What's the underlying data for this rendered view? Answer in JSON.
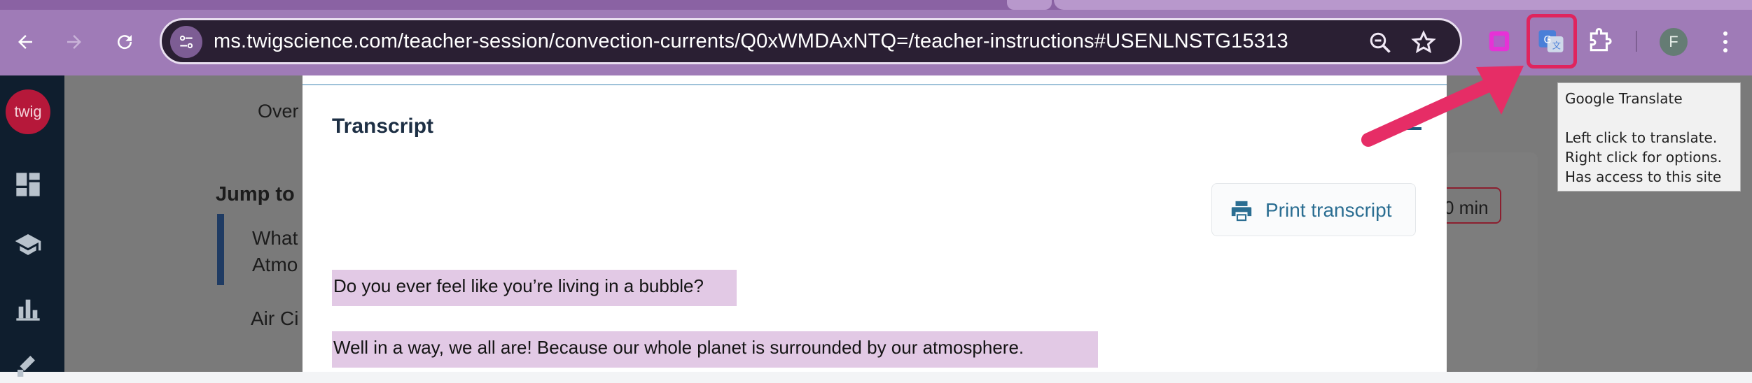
{
  "browser": {
    "url": "ms.twigscience.com/teacher-session/convection-currents/Q0xWMDAxNTQ=/teacher-instructions#USENLNSTG15313",
    "profile_initial": "F",
    "icons": [
      "back-arrow-icon",
      "forward-arrow-icon",
      "reload-icon",
      "site-info-icon",
      "zoom-icon",
      "bookmark-star-icon",
      "extension-pink-icon",
      "google-translate-icon",
      "extensions-puzzle-icon",
      "more-menu-icon"
    ]
  },
  "tooltip": {
    "title": "Google Translate",
    "line1": "Left click to translate.",
    "line2": "Right click for options.",
    "line3": "Has access to this site"
  },
  "app": {
    "logo_text": "twig",
    "sidebar_icons": [
      "dashboard-icon",
      "graduation-cap-icon",
      "bar-chart-icon",
      "tools-icon"
    ],
    "background": {
      "tab_label": "Over",
      "jump_label": "Jump to",
      "link1_line1": "What",
      "link1_line2": "Atmo",
      "link2": "Air Ci",
      "time_text": "0 min"
    }
  },
  "modal": {
    "title": "Transcript",
    "print_label": "Print transcript",
    "lines": [
      "Do you ever feel like you’re living in a bubble?",
      "Well in a way, we all are! Because our whole planet is surrounded by our atmosphere."
    ]
  },
  "colors": {
    "chrome": "#9f7bb7",
    "omnibox": "#2a1f33",
    "highlight": "#e0245e",
    "transcript_highlight": "#e2c9e5",
    "accent": "#2b6e92"
  }
}
